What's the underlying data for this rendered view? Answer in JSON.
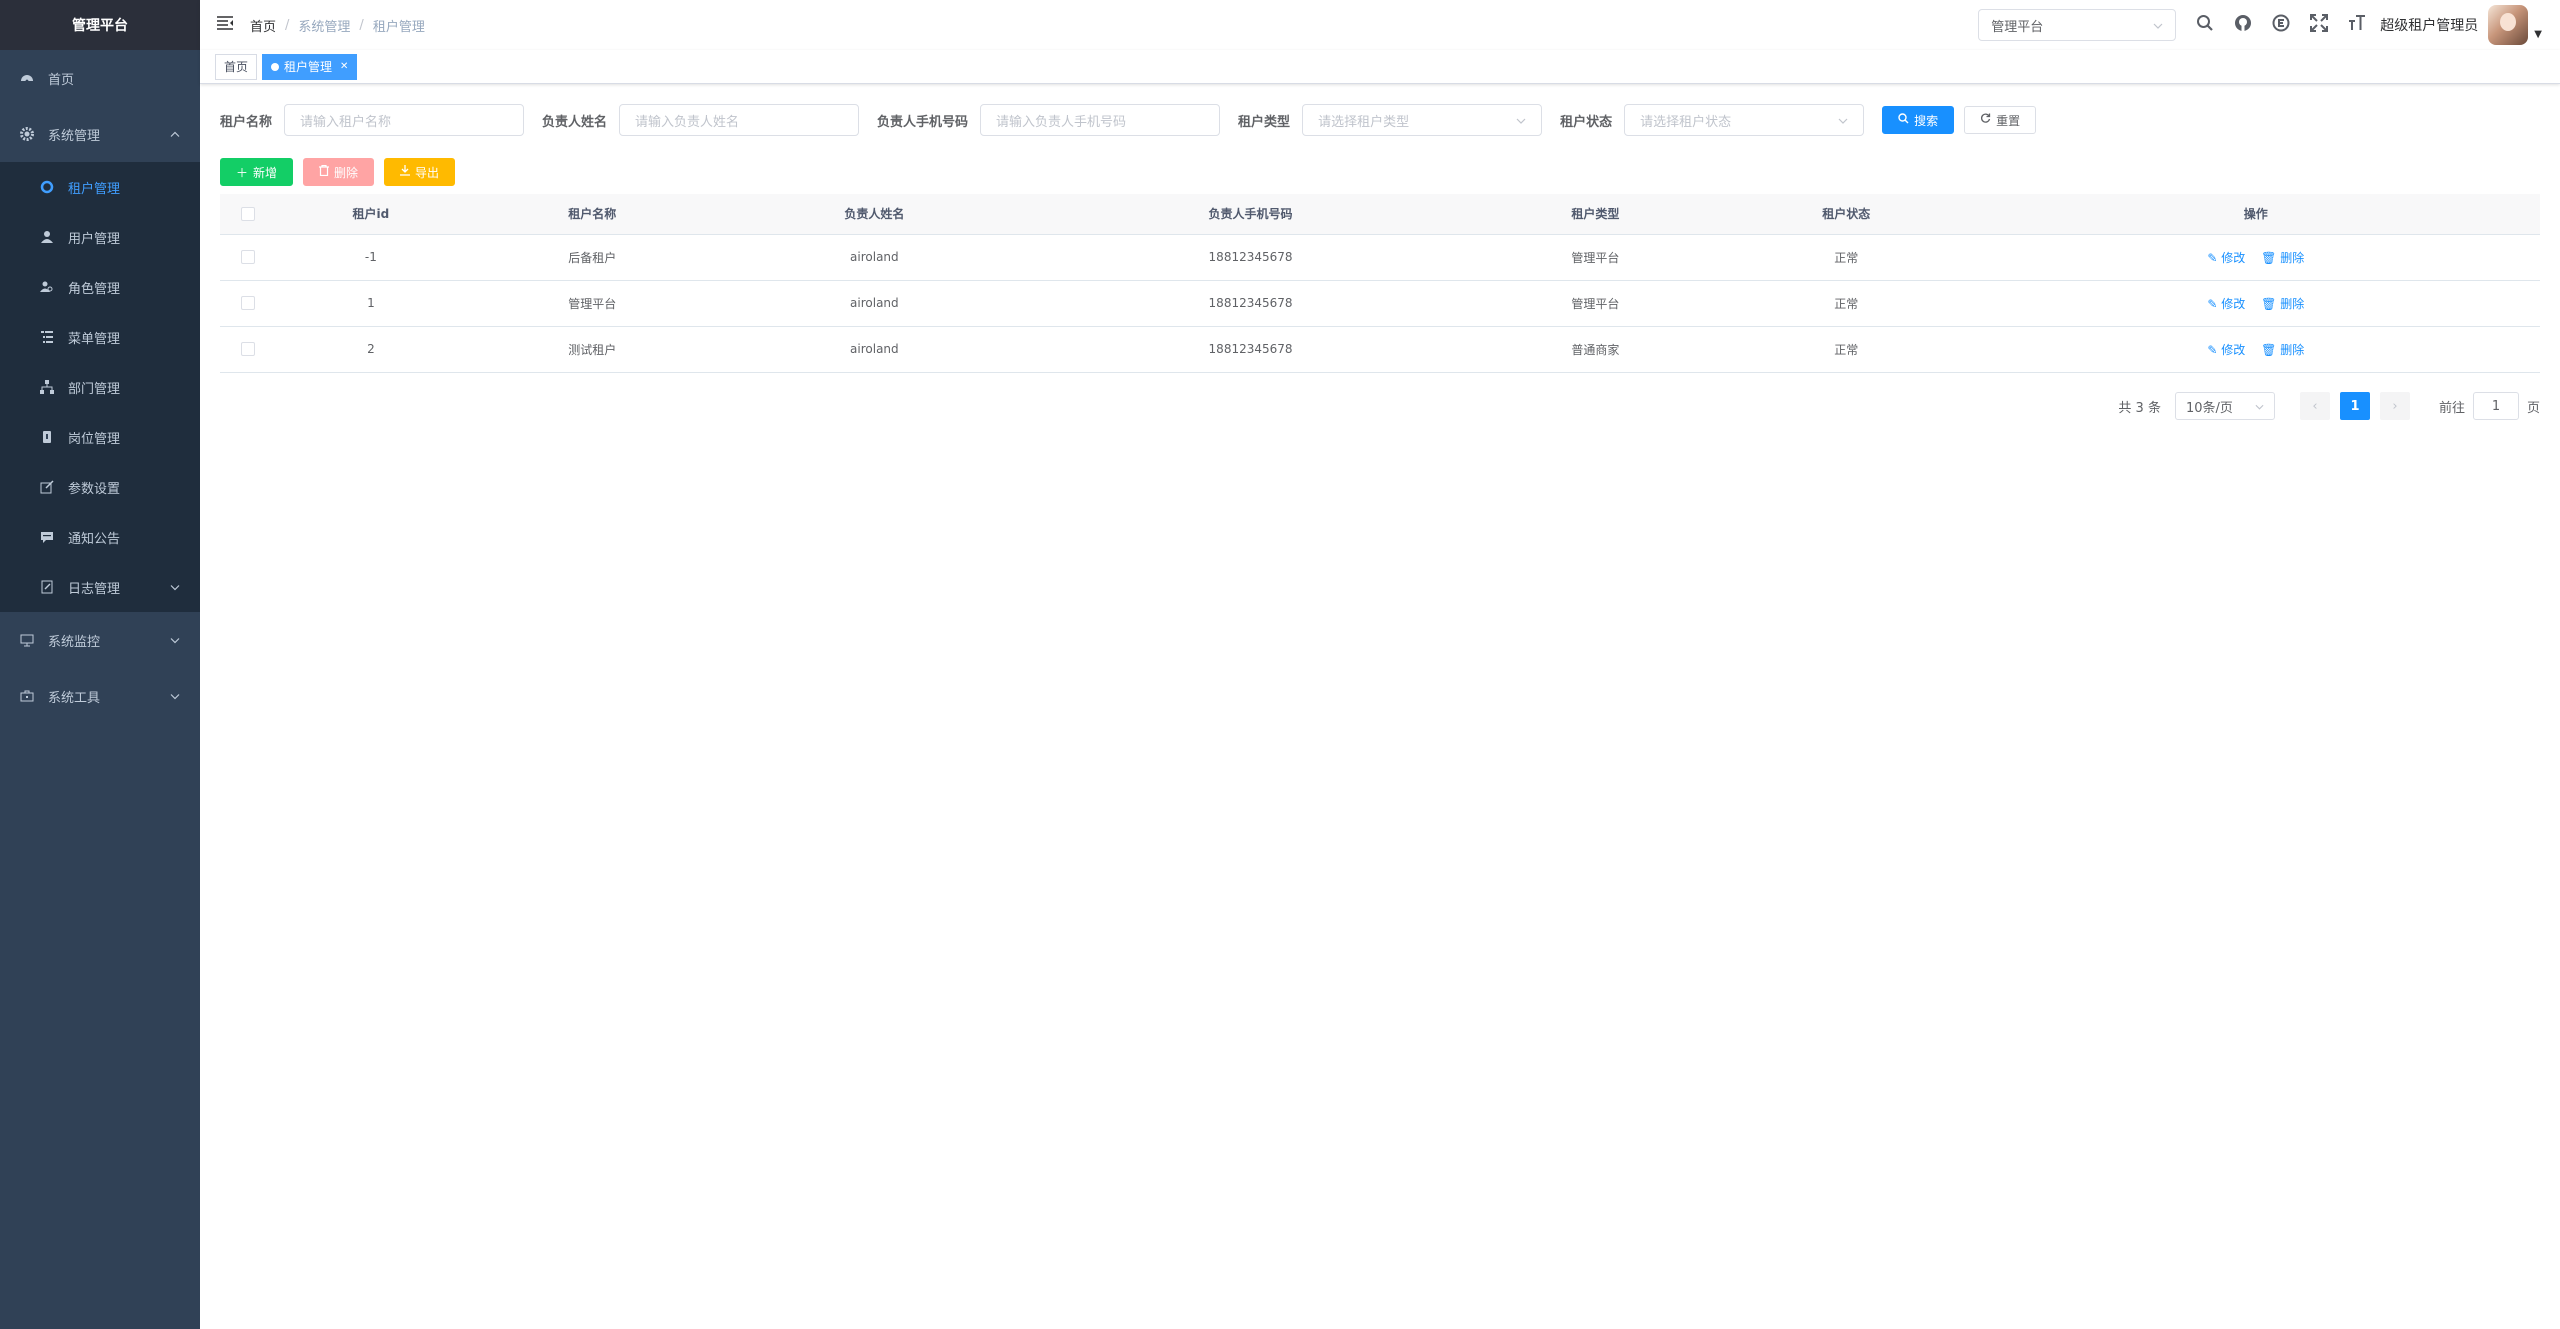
{
  "app": {
    "title": "管理平台"
  },
  "sidebar": {
    "items": [
      {
        "label": "首页",
        "icon": "dashboard-icon"
      },
      {
        "label": "系统管理",
        "icon": "gear-icon",
        "expanded": true,
        "children": [
          {
            "label": "租户管理",
            "icon": "tenant-icon",
            "active": true
          },
          {
            "label": "用户管理",
            "icon": "user-icon"
          },
          {
            "label": "角色管理",
            "icon": "role-icon"
          },
          {
            "label": "菜单管理",
            "icon": "menu-tree-icon"
          },
          {
            "label": "部门管理",
            "icon": "org-tree-icon"
          },
          {
            "label": "岗位管理",
            "icon": "post-icon"
          },
          {
            "label": "参数设置",
            "icon": "edit-icon"
          },
          {
            "label": "通知公告",
            "icon": "message-icon"
          },
          {
            "label": "日志管理",
            "icon": "log-icon",
            "expandable": true
          }
        ]
      },
      {
        "label": "系统监控",
        "icon": "monitor-icon",
        "expandable": true
      },
      {
        "label": "系统工具",
        "icon": "toolbox-icon",
        "expandable": true
      }
    ]
  },
  "navbar": {
    "breadcrumb": [
      "首页",
      "系统管理",
      "租户管理"
    ],
    "tenant_select": "管理平台",
    "username": "超级租户管理员",
    "icons": [
      "search-icon",
      "github-icon",
      "document-icon",
      "fullscreen-icon",
      "font-size-icon"
    ]
  },
  "tags": [
    {
      "label": "首页",
      "active": false
    },
    {
      "label": "租户管理",
      "active": true
    }
  ],
  "search": {
    "name_label": "租户名称",
    "name_placeholder": "请输入租户名称",
    "contact_label": "负责人姓名",
    "contact_placeholder": "请输入负责人姓名",
    "phone_label": "负责人手机号码",
    "phone_placeholder": "请输入负责人手机号码",
    "type_label": "租户类型",
    "type_placeholder": "请选择租户类型",
    "status_label": "租户状态",
    "status_placeholder": "请选择租户状态",
    "search_btn": "搜索",
    "reset_btn": "重置"
  },
  "toolbar": {
    "add": "新增",
    "delete": "删除",
    "export": "导出"
  },
  "table": {
    "columns": [
      "租户id",
      "租户名称",
      "负责人姓名",
      "负责人手机号码",
      "租户类型",
      "租户状态",
      "操作"
    ],
    "rows": [
      {
        "id": "-1",
        "name": "后备租户",
        "contact": "airoland",
        "phone": "18812345678",
        "type": "管理平台",
        "status": "正常"
      },
      {
        "id": "1",
        "name": "管理平台",
        "contact": "airoland",
        "phone": "18812345678",
        "type": "管理平台",
        "status": "正常"
      },
      {
        "id": "2",
        "name": "测试租户",
        "contact": "airoland",
        "phone": "18812345678",
        "type": "普通商家",
        "status": "正常"
      }
    ],
    "edit_label": "修改",
    "delete_label": "删除"
  },
  "pagination": {
    "total_text": "共 3 条",
    "page_size": "10条/页",
    "current_page": "1",
    "goto_label": "前往",
    "goto_value": "1",
    "page_suffix": "页"
  },
  "colors": {
    "sidebar": "#304156",
    "primary": "#1890ff",
    "success": "#13ce66",
    "warning": "#ffba00"
  }
}
